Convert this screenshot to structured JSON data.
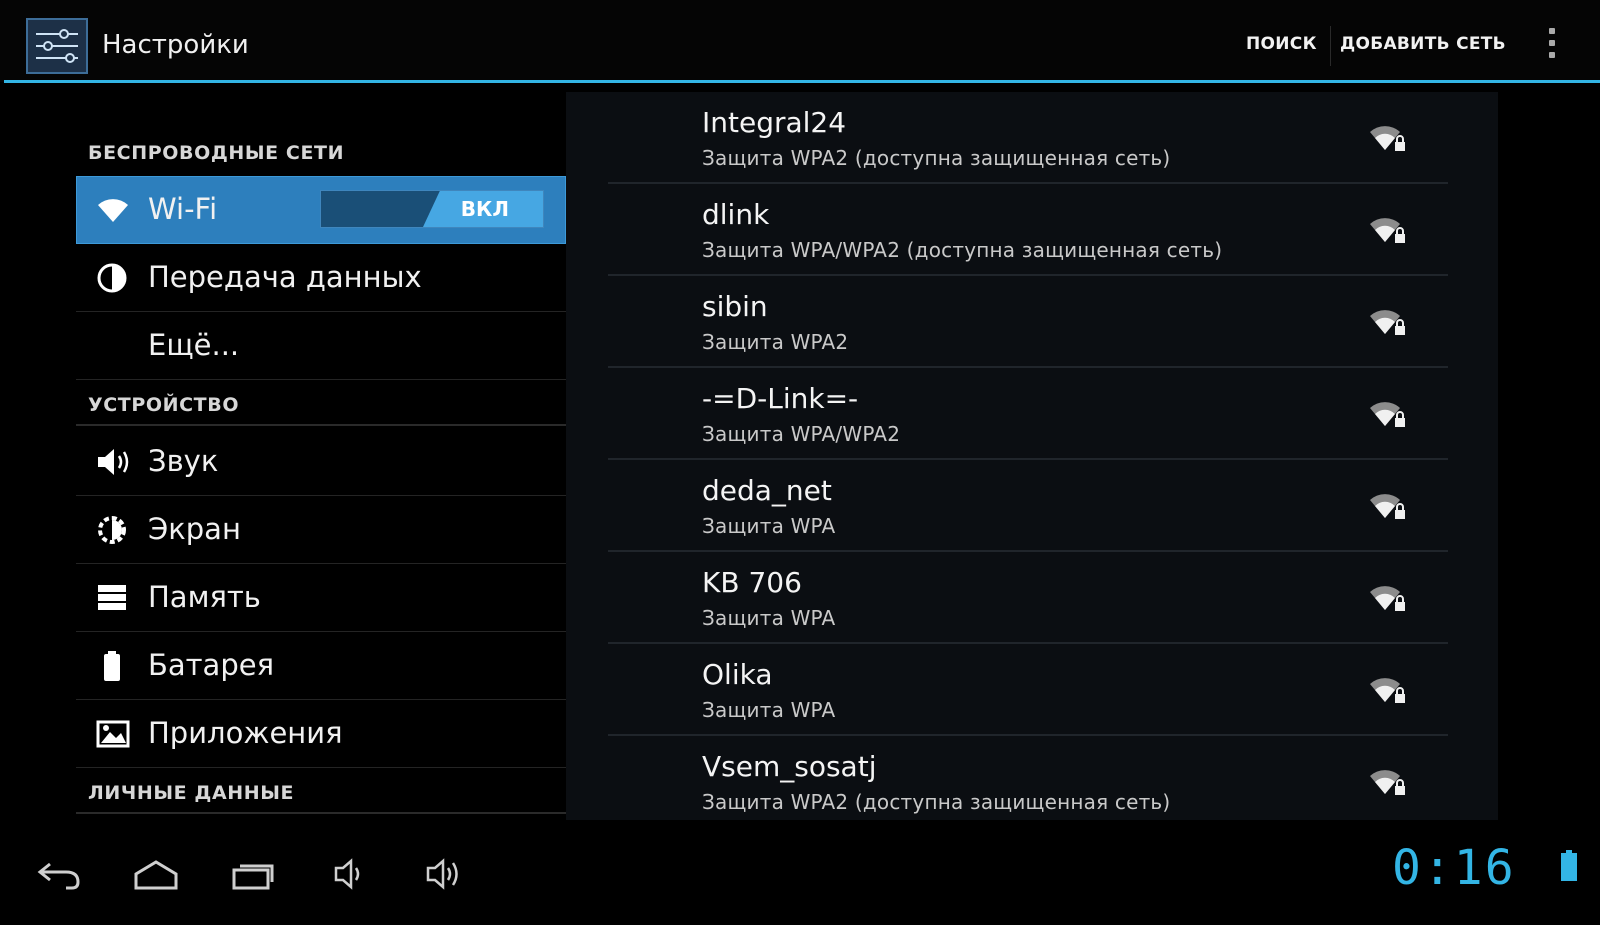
{
  "actionbar": {
    "title": "Настройки",
    "search_label": "ПОИСК",
    "add_network_label": "ДОБАВИТЬ СЕТЬ"
  },
  "sidebar": {
    "sections": [
      {
        "header": "БЕСПРОВОДНЫЕ СЕТИ"
      },
      {
        "header": "УСТРОЙСТВО"
      },
      {
        "header": "ЛИЧНЫЕ ДАННЫЕ"
      }
    ],
    "items": [
      {
        "label": "Wi-Fi",
        "icon": "wifi-icon",
        "selected": true,
        "toggle": "ВКЛ"
      },
      {
        "label": "Передача данных",
        "icon": "data-usage-icon"
      },
      {
        "label": "Ещё..."
      },
      {
        "label": "Звук",
        "icon": "sound-icon"
      },
      {
        "label": "Экран",
        "icon": "display-icon"
      },
      {
        "label": "Память",
        "icon": "storage-icon"
      },
      {
        "label": "Батарея",
        "icon": "battery-icon"
      },
      {
        "label": "Приложения",
        "icon": "apps-icon"
      }
    ]
  },
  "networks": [
    {
      "ssid": "Integral24",
      "security": "Защита WPA2 (доступна защищенная сеть)"
    },
    {
      "ssid": "dlink",
      "security": "Защита WPA/WPA2 (доступна защищенная сеть)"
    },
    {
      "ssid": "sibin",
      "security": "Защита WPA2"
    },
    {
      "ssid": "-=D-Link=-",
      "security": "Защита WPA/WPA2"
    },
    {
      "ssid": "deda_net",
      "security": "Защита WPA"
    },
    {
      "ssid": "KB 706",
      "security": "Защита WPA"
    },
    {
      "ssid": "Olika",
      "security": "Защита WPA"
    },
    {
      "ssid": "Vsem_sosatj",
      "security": "Защита WPA2 (доступна защищенная сеть)"
    }
  ],
  "systembar": {
    "clock": "0:16",
    "accent": "#33b5e5"
  }
}
